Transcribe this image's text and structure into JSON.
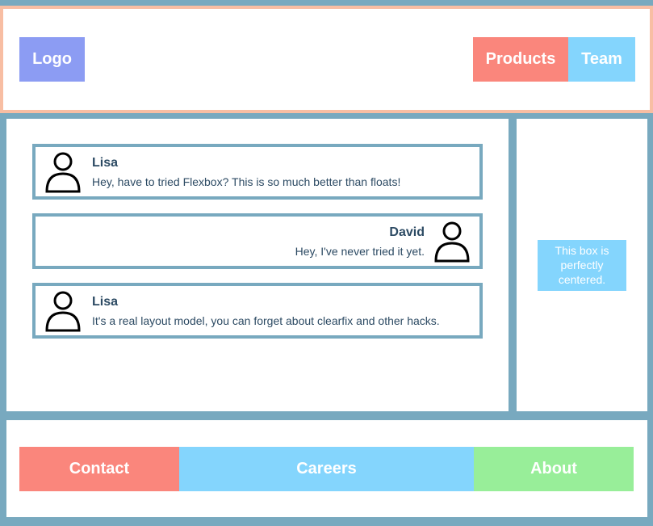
{
  "header": {
    "logo_label": "Logo",
    "nav": [
      {
        "label": "Products"
      },
      {
        "label": "Team"
      }
    ]
  },
  "messages": [
    {
      "name": "Lisa",
      "text": "Hey, have to tried Flexbox? This is so much better than floats!",
      "align": "left"
    },
    {
      "name": "David",
      "text": "Hey, I've never tried it yet.",
      "align": "right"
    },
    {
      "name": "Lisa",
      "text": "It's a real layout model, you can forget about clearfix and other hacks.",
      "align": "left"
    }
  ],
  "sidebar": {
    "centered_text": "This box is perfectly centered."
  },
  "footer": {
    "nav": [
      {
        "label": "Contact"
      },
      {
        "label": "Careers"
      },
      {
        "label": "About"
      }
    ]
  },
  "colors": {
    "frame": "#78a9bf",
    "header_border": "#f8bea3",
    "logo": "#8c9cf3",
    "red": "#fa867c",
    "blue": "#84d5fd",
    "green": "#98ee99"
  },
  "icons": {
    "avatar": "person-icon"
  }
}
